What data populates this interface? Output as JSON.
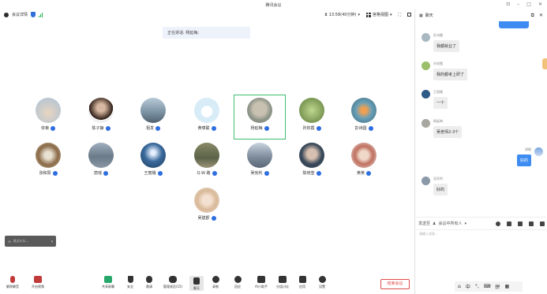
{
  "window": {
    "title": "腾讯会议"
  },
  "toolbar": {
    "meeting_info": "会议详情",
    "timer": "13:58(40分钟)",
    "view": "宫格视图"
  },
  "speaking": "正在讲话: 杨延梅;",
  "participants": [
    {
      "name": "依菊",
      "color": "#c8b8a7"
    },
    {
      "name": "陈子静",
      "color": "#3b2a22"
    },
    {
      "name": "祖发",
      "color": "#9ab0c0"
    },
    {
      "name": "黄啸聪",
      "color": "#d8e8f4"
    },
    {
      "name": "杨延梅",
      "color": "#b0b7ad"
    },
    {
      "name": "孙姣霞",
      "color": "#7a9a52"
    },
    {
      "name": "彭诗圆",
      "color": "#5a8a9a"
    },
    {
      "name": "张和阳",
      "color": "#a08060"
    },
    {
      "name": "唐瑶",
      "color": "#7b8fa0"
    },
    {
      "name": "王丽娥",
      "color": "#3a6d9c"
    },
    {
      "name": "Q.W 路",
      "color": "#7b7a5a"
    },
    {
      "name": "吴宪利",
      "color": "#8d9aa8"
    },
    {
      "name": "陈晓莹",
      "color": "#4a5a6a"
    },
    {
      "name": "黄英",
      "color": "#c0a090"
    },
    {
      "name": "吴建郡",
      "color": "#e0c8b0"
    }
  ],
  "bottom_input": {
    "placeholder": "说点什么..."
  },
  "bottombar": {
    "mute": "解除静音",
    "video": "开启视频",
    "share": "共享屏幕",
    "security": "安全",
    "invite": "邀请",
    "members": "管理成员(15)",
    "chat": "聊天",
    "record": "录制",
    "react": "回应",
    "ai": "AI小助手",
    "breakout": "分组讨论",
    "apps": "应用",
    "settings": "设置",
    "end": "结束会议"
  },
  "chat": {
    "title": "聊天",
    "messages": [
      {
        "sender": "彭诗圆",
        "text": "我都就业了"
      },
      {
        "sender": "孙姣霞",
        "text": "我的都考上研了"
      },
      {
        "sender": "王丽娥",
        "text": "一个"
      },
      {
        "sender": "杨延梅",
        "text": "吴老师2-3个"
      },
      {
        "sender": "胡聪",
        "text": "好的",
        "self": true
      },
      {
        "sender": "吴宪利",
        "text": "好的"
      }
    ],
    "send_to_label": "发送至",
    "send_to_value": "会议中所有人",
    "input_placeholder": "请输入消息..."
  },
  "tray": {
    "ime": "中",
    "label": "拼"
  },
  "colors": {
    "accent": "#2e6ee0",
    "end": "#e24a4a",
    "speaker_border": "#3bbf6e"
  }
}
